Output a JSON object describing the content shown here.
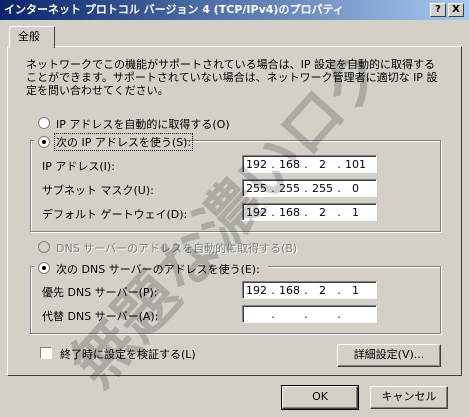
{
  "window": {
    "title": "インターネット プロトコル バージョン 4 (TCP/IPv4)のプロパティ",
    "help_btn": "?",
    "close_btn": "X"
  },
  "tabs": [
    {
      "label": "全般"
    }
  ],
  "description": "ネットワークでこの機能がサポートされている場合は、IP 設定を自動的に取得することができます。サポートされていない場合は、ネットワーク管理者に適切な IP 設定を問い合わせてください。",
  "ip_section": {
    "auto_label": "IP アドレスを自動的に取得する(O)",
    "manual_label": "次の IP アドレスを使う(S):",
    "selected": "manual",
    "fields": [
      {
        "label": "IP アドレス(I):",
        "octets": [
          "192",
          "168",
          "2",
          "101"
        ]
      },
      {
        "label": "サブネット マスク(U):",
        "octets": [
          "255",
          "255",
          "255",
          "0"
        ]
      },
      {
        "label": "デフォルト ゲートウェイ(D):",
        "octets": [
          "192",
          "168",
          "2",
          "1"
        ]
      }
    ]
  },
  "dns_section": {
    "auto_label": "DNS サーバーのアドレスを自動的に取得する(B)",
    "manual_label": "次の DNS サーバーのアドレスを使う(E):",
    "selected": "manual",
    "fields": [
      {
        "label": "優先 DNS サーバー(P):",
        "octets": [
          "192",
          "168",
          "2",
          "1"
        ]
      },
      {
        "label": "代替 DNS サーバー(A):",
        "octets": [
          "",
          "",
          "",
          ""
        ]
      }
    ]
  },
  "validate_label": "終了時に設定を検証する(L)",
  "validate_checked": false,
  "advanced_btn": "詳細設定(V)...",
  "ok_btn": "OK",
  "cancel_btn": "キャンセル",
  "watermark_text": "無題な濃いログ"
}
